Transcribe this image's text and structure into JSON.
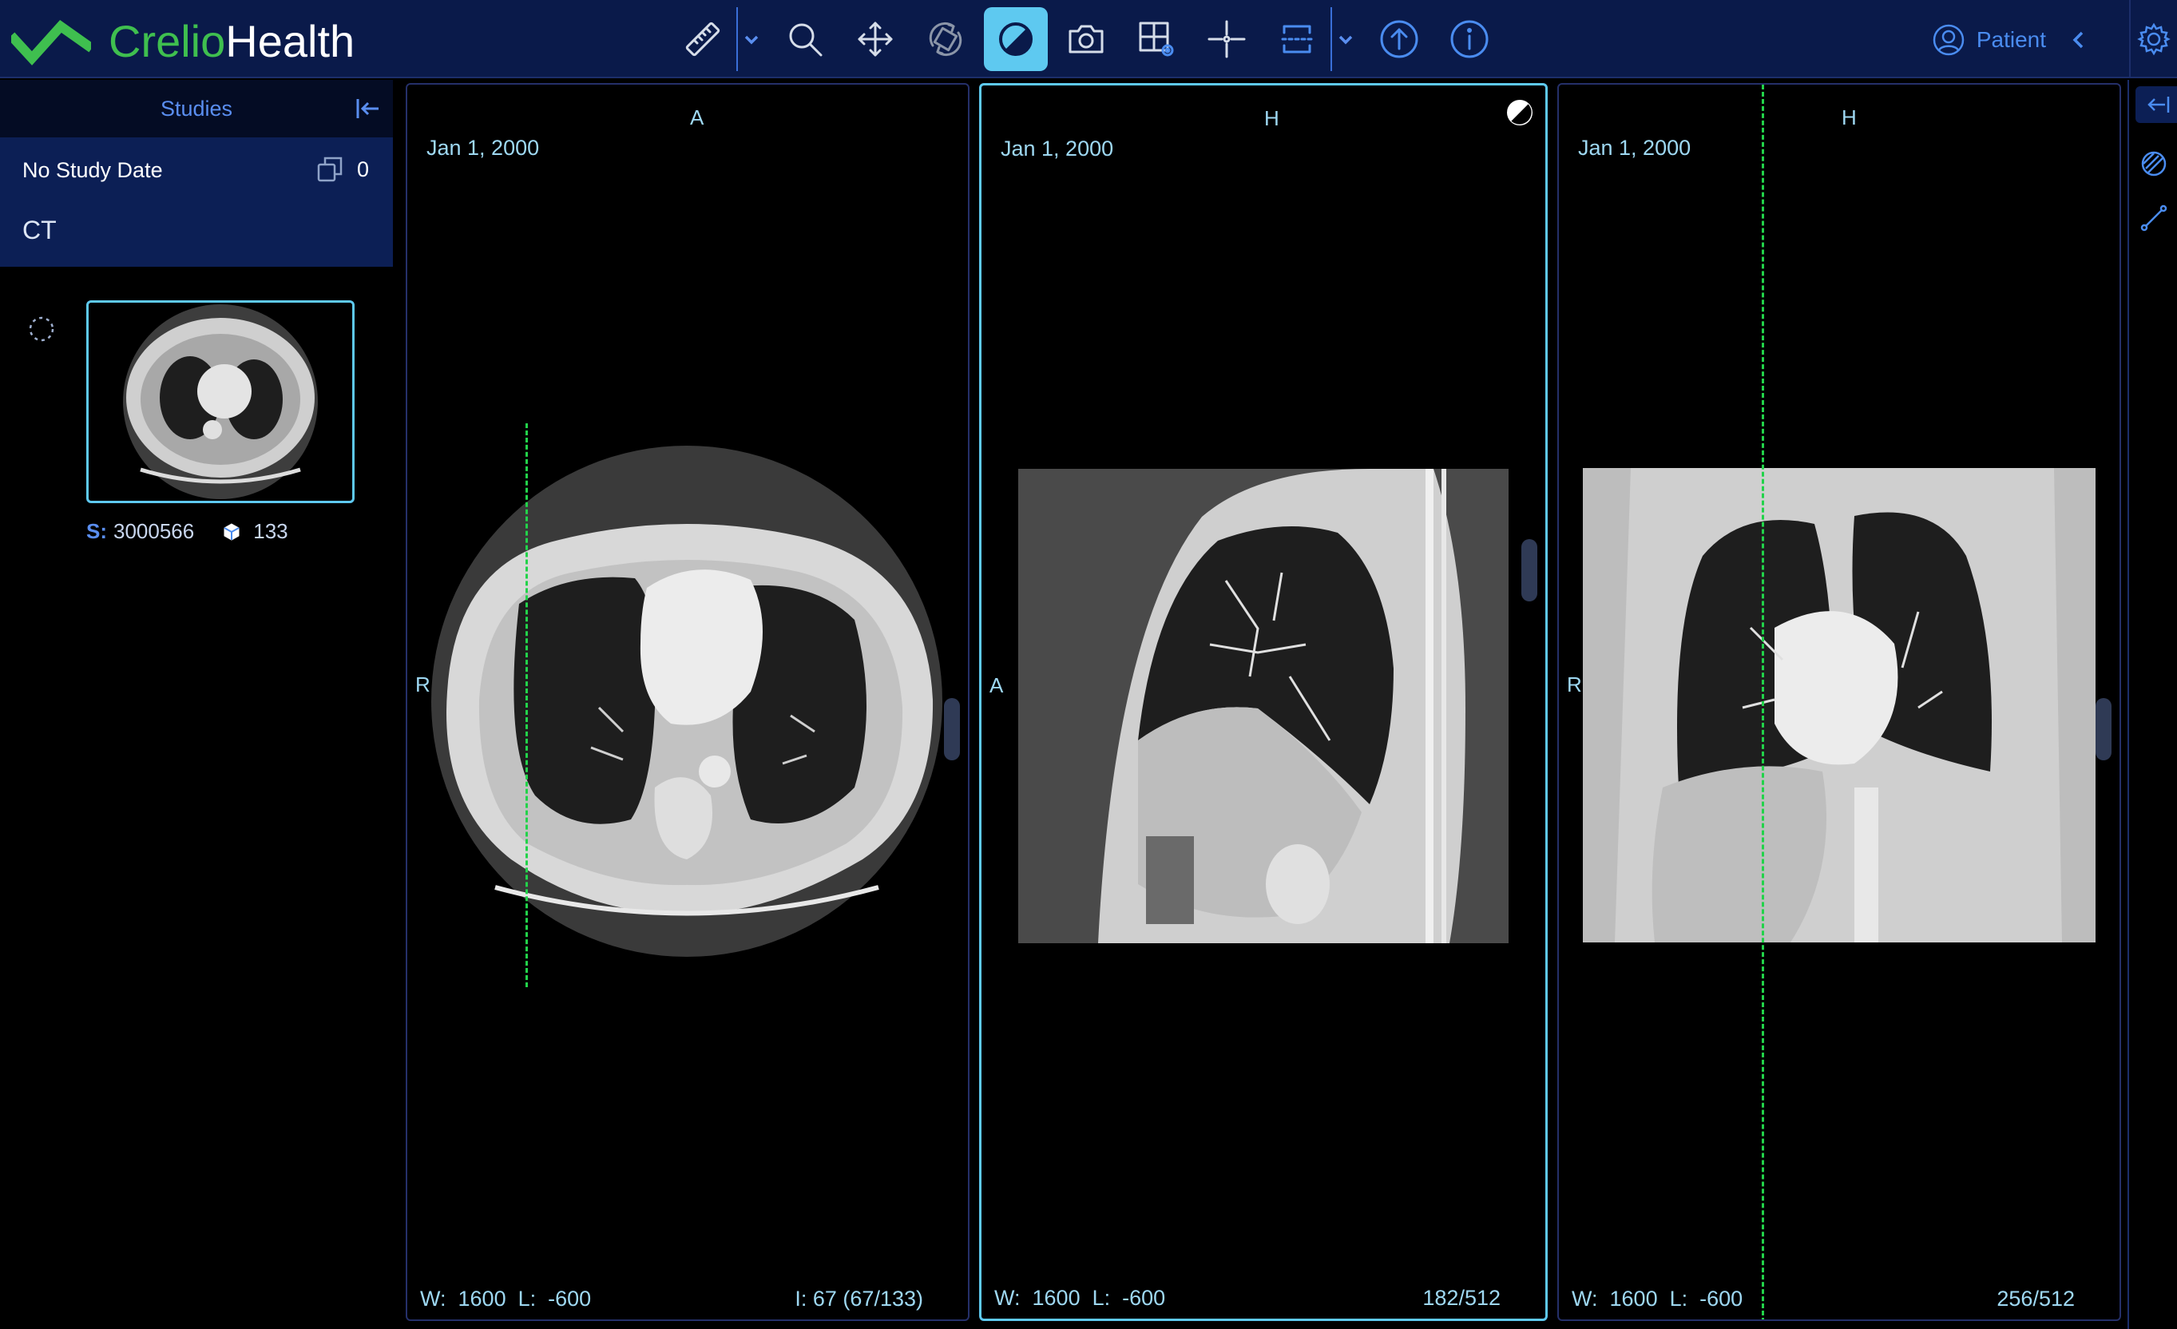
{
  "app": {
    "brand_part1": "Crelio",
    "brand_part2": "Health",
    "brand_color": "#3fbf4f"
  },
  "toolbar": {
    "tools": [
      {
        "name": "ruler-icon",
        "active": false
      },
      {
        "name": "zoom-icon",
        "active": false
      },
      {
        "name": "pan-icon",
        "active": false
      },
      {
        "name": "rotate-icon",
        "active": false
      },
      {
        "name": "window-level-icon",
        "active": true
      },
      {
        "name": "camera-icon",
        "active": false
      },
      {
        "name": "layout-settings-icon",
        "active": false
      },
      {
        "name": "crosshair-icon",
        "active": false
      },
      {
        "name": "mpr-icon",
        "active": false
      },
      {
        "name": "upload-icon",
        "active": false
      },
      {
        "name": "info-icon",
        "active": false
      }
    ],
    "accent": "#5ec9f0"
  },
  "header": {
    "patient_label": "Patient"
  },
  "studies_panel": {
    "title": "Studies",
    "study": {
      "date": "No Study Date",
      "count": "0",
      "modality": "CT"
    },
    "series": {
      "s_label": "S:",
      "series_number": "3000566",
      "instance_count": "133"
    }
  },
  "viewports": [
    {
      "date": "Jan 1, 2000",
      "top_orientation": "A",
      "left_orientation": "R",
      "w_label": "W:",
      "w_value": "1600",
      "l_label": "L:",
      "l_value": "-600",
      "index": "I: 67 (67/133)",
      "view": "axial"
    },
    {
      "date": "Jan 1, 2000",
      "top_orientation": "H",
      "left_orientation": "A",
      "w_label": "W:",
      "w_value": "1600",
      "l_label": "L:",
      "l_value": "-600",
      "index": "182/512",
      "view": "sagittal"
    },
    {
      "date": "Jan 1, 2000",
      "top_orientation": "H",
      "left_orientation": "R",
      "w_label": "W:",
      "w_value": "1600",
      "l_label": "L:",
      "l_value": "-600",
      "index": "256/512",
      "view": "coronal"
    }
  ]
}
